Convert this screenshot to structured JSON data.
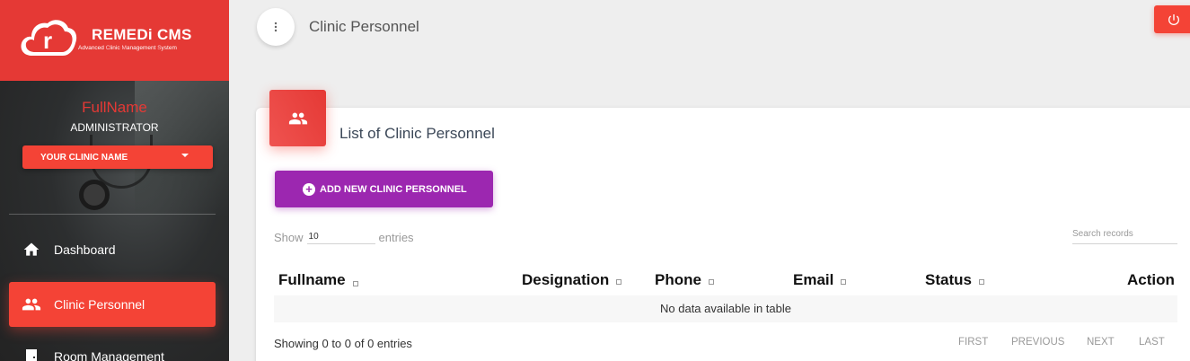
{
  "brand": {
    "title": "REMEDi CMS",
    "subtitle_parts": [
      "Advanced ",
      "C",
      "linic ",
      "M",
      "anagement ",
      "S",
      "ystem"
    ]
  },
  "user": {
    "name": "FullName",
    "role": "ADMINISTRATOR",
    "clinic_select": "YOUR CLINIC NAME"
  },
  "sidebar": {
    "items": [
      {
        "label": "Dashboard",
        "icon": "home-icon",
        "active": false
      },
      {
        "label": "Clinic Personnel",
        "icon": "people-icon",
        "active": true
      },
      {
        "label": "Room Management",
        "icon": "door-icon",
        "active": false
      }
    ]
  },
  "header": {
    "title": "Clinic Personnel",
    "menu_icon": "more-vert-icon",
    "power_icon": "power-icon"
  },
  "card": {
    "title": "List of Clinic Personnel",
    "icon": "people-icon",
    "add_button": "ADD NEW CLINIC PERSONNEL"
  },
  "table": {
    "show_label": "Show",
    "entries_label": "entries",
    "page_length": "10",
    "search_placeholder": "Search records",
    "columns": [
      "Fullname",
      "Designation",
      "Phone",
      "Email",
      "Status",
      "Action"
    ],
    "empty_message": "No data available in table",
    "info": "Showing 0 to 0 of 0 entries",
    "pagination": [
      "FIRST",
      "PREVIOUS",
      "NEXT",
      "LAST"
    ]
  },
  "colors": {
    "accent": "#f44336",
    "brand": "#e53935",
    "add_button": "#9c27b0",
    "sidebar": "#2f2f2f"
  }
}
